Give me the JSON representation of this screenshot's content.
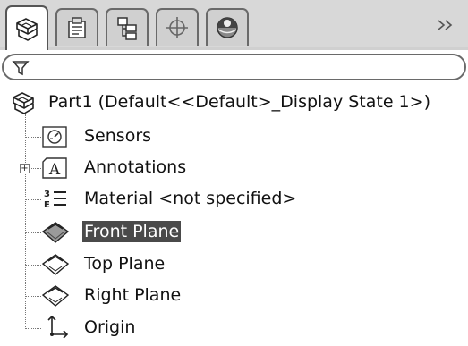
{
  "tabs": [
    {
      "name": "feature-manager",
      "active": true
    },
    {
      "name": "property-manager",
      "active": false
    },
    {
      "name": "configuration-manager",
      "active": false
    },
    {
      "name": "dimxpert-manager",
      "active": false
    },
    {
      "name": "display-manager",
      "active": false
    }
  ],
  "filter": {
    "placeholder": "",
    "value": ""
  },
  "tree": {
    "root": {
      "label": "Part1  (Default<<Default>_Display State 1>)",
      "icon": "part-icon"
    },
    "items": [
      {
        "label": "Sensors",
        "icon": "sensors-icon",
        "expandable": false,
        "selected": false
      },
      {
        "label": "Annotations",
        "icon": "annotations-icon",
        "expandable": true,
        "expander": "+",
        "selected": false
      },
      {
        "label": "Material <not specified>",
        "icon": "material-icon",
        "expandable": false,
        "selected": false
      },
      {
        "label": "Front Plane",
        "icon": "plane-icon",
        "expandable": false,
        "selected": true
      },
      {
        "label": "Top Plane",
        "icon": "plane-icon",
        "expandable": false,
        "selected": false
      },
      {
        "label": "Right Plane",
        "icon": "plane-icon",
        "expandable": false,
        "selected": false
      },
      {
        "label": "Origin",
        "icon": "origin-icon",
        "expandable": false,
        "selected": false
      }
    ]
  },
  "colors": {
    "tabbar": "#d8d8d8",
    "selection_bg": "#4a4a4a",
    "selection_fg": "#ffffff"
  }
}
